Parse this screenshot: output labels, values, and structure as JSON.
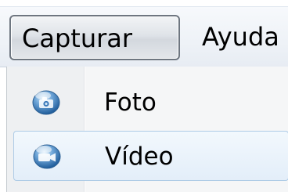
{
  "menubar": {
    "items": [
      {
        "label": "Capturar"
      },
      {
        "label": "Ayuda"
      }
    ]
  },
  "dropdown": {
    "items": [
      {
        "label": "Foto",
        "icon": "camera-icon"
      },
      {
        "label": "Vídeo",
        "icon": "video-camera-icon"
      }
    ]
  },
  "colors": {
    "hover_highlight": "#e3eef9",
    "hover_border": "#aecbe6",
    "icon_blue": "#2d6fb0"
  }
}
